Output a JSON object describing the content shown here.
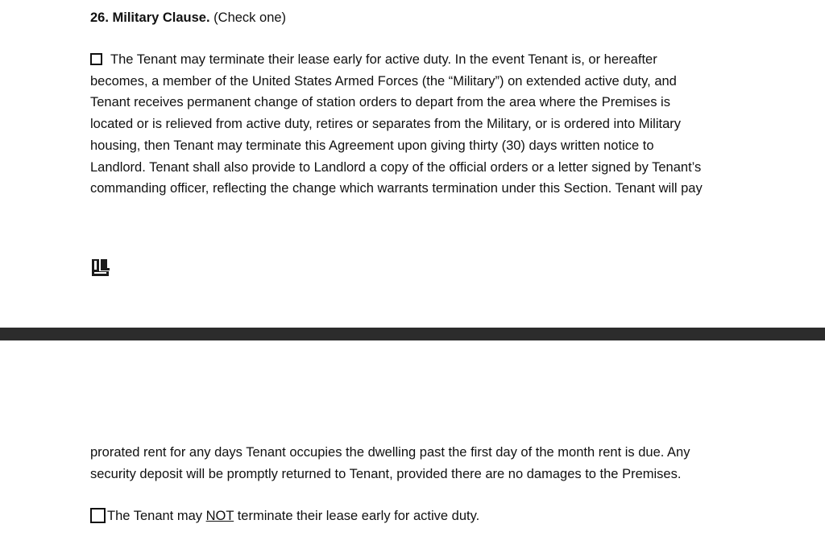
{
  "section": {
    "number_title": "26. Military Clause.",
    "instruction": "(Check one)"
  },
  "option1": {
    "lines": [
      "The Tenant may terminate their lease early for active duty. In the event Tenant is, or hereafter",
      "becomes, a member of the United States Armed Forces (the “Military”) on extended active duty, and",
      "Tenant receives permanent change of station orders to depart from the area where the Premises is",
      "located or is relieved from active duty, retires or separates from the Military, or is ordered into Military",
      "housing, then Tenant may terminate this Agreement upon giving thirty (30) days written notice to",
      "Landlord. Tenant shall also provide to Landlord a copy of the official orders or a letter signed by Tenant’s",
      "commanding officer, reflecting the change which warrants termination under this Section. Tenant will pay"
    ],
    "continuation_lines": [
      "prorated rent for any days Tenant occupies the dwelling past the first day of the month rent is due. Any",
      "security deposit will be promptly returned to Tenant, provided there are no damages to the Premises."
    ],
    "checked": false
  },
  "option2": {
    "text_before": "The Tenant may ",
    "text_underlined": "NOT",
    "text_after": " terminate their lease early for active duty.",
    "checked": false
  },
  "icons": {
    "page_icon": "document-pages-icon"
  }
}
